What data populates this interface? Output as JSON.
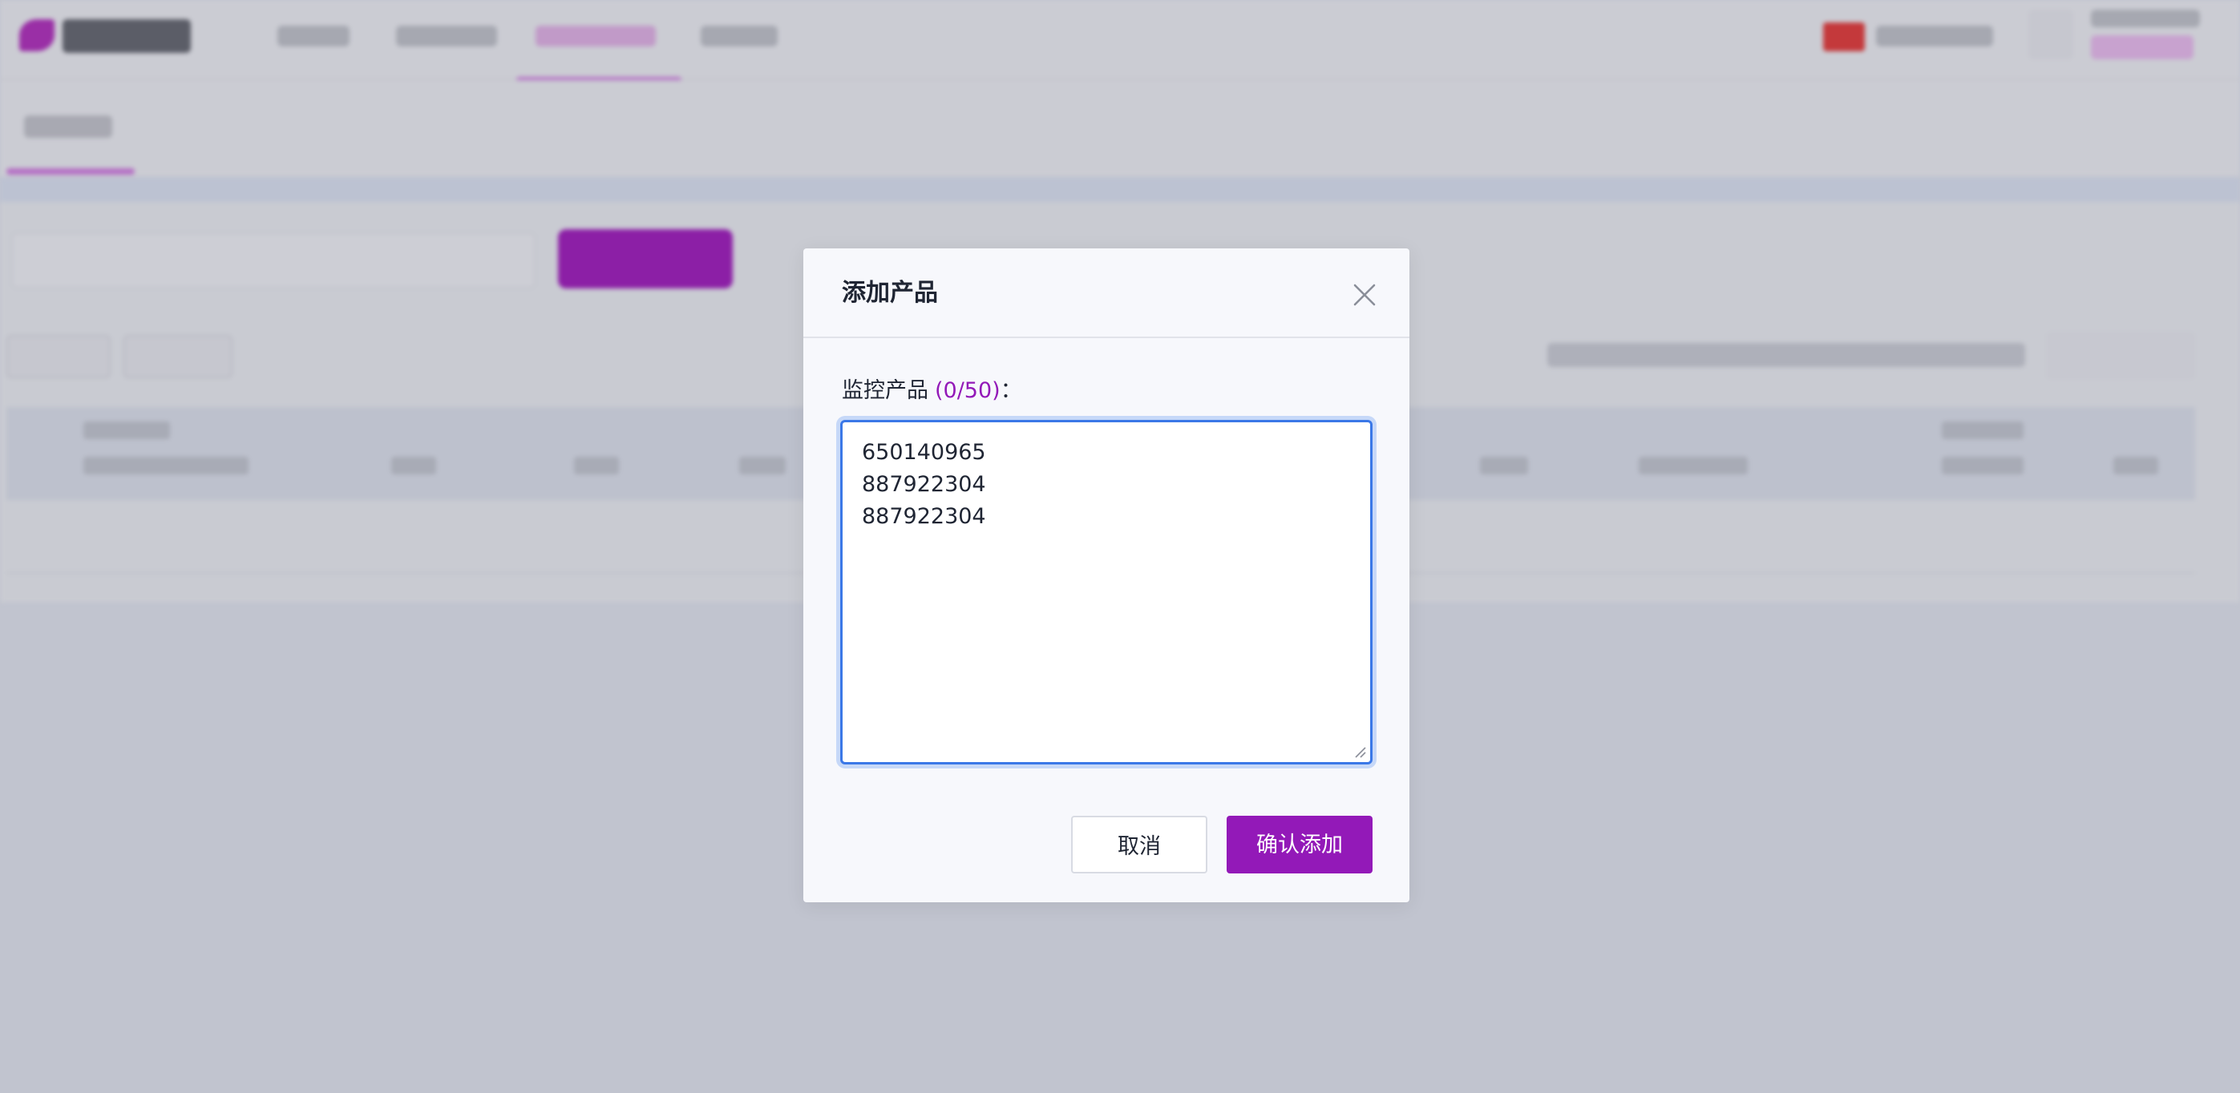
{
  "modal": {
    "title": "添加产品",
    "field_label": "监控产品",
    "counter": "(0/50)",
    "colon": "：",
    "textarea_value": "650140965\n887922304\n887922304",
    "cancel_label": "取消",
    "confirm_label": "确认添加"
  },
  "colors": {
    "accent": "#9319b8",
    "focus_ring": "#3b78e7",
    "overlay": "#c1c4cf"
  },
  "icons": {
    "close": "close-icon",
    "resize": "resize-grip-icon"
  }
}
